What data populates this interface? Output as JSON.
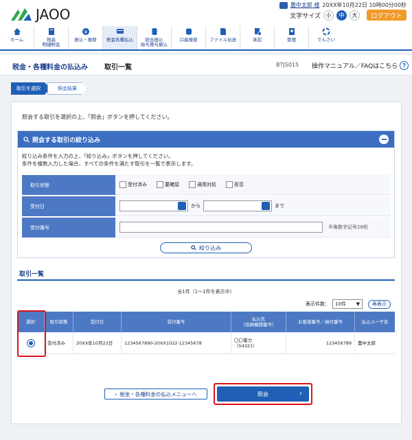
{
  "brand": {
    "name": "JAOO",
    "color": "#1f5fb5"
  },
  "header": {
    "user_name": "農中太郎 様",
    "datetime": "20XX年10月22日 10時00分00秒",
    "font_size_label": "文字サイズ",
    "font_sizes": [
      "小",
      "中",
      "大"
    ],
    "logout_label": "ログアウト"
  },
  "nav": [
    {
      "label": "ホーム",
      "icon": "home-icon"
    },
    {
      "label": "残高\n明細照会",
      "icon": "book-icon"
    },
    {
      "label": "振込・振替",
      "icon": "yen-icon"
    },
    {
      "label": "税金各種払込",
      "icon": "card-icon"
    },
    {
      "label": "総合振込\n給与賞与振込",
      "icon": "stack-icon"
    },
    {
      "label": "口座振替",
      "icon": "coins-icon"
    },
    {
      "label": "ファイル伝送",
      "icon": "file-icon"
    },
    {
      "label": "承認",
      "icon": "approve-icon"
    },
    {
      "label": "管理",
      "icon": "admin-icon"
    },
    {
      "label": "でんさい",
      "icon": "densai-icon"
    }
  ],
  "title": {
    "main": "税金・各種料金の払込み",
    "sub": "取引一覧",
    "code": "BTJS015",
    "help": "操作マニュアル／FAQはこちら"
  },
  "steps": [
    "取引を選択",
    "照会結果"
  ],
  "instruction": "照会する取引を選択の上、「照会」ボタンを押してください。",
  "filter": {
    "title": "照会する取引の絞り込み",
    "desc1": "絞り込み条件を入力の上、「絞り込み」ボタンを押してください。",
    "desc2": "条件を複数入力した場合、すべての条件を満たす取引を一覧で表示します。",
    "status_label": "取引状態",
    "status_options": [
      "受付済み",
      "要確認",
      "適用対処",
      "拒否"
    ],
    "date_label": "受付日",
    "date_from": "から",
    "date_to": "まで",
    "number_label": "受付番号",
    "number_hint": "半角数字記号28桁",
    "search_label": "絞り込み"
  },
  "list": {
    "title": "取引一覧",
    "count": "全1件（1～1件を表示中）",
    "perpage_label": "表示件数：",
    "perpage_value": "10件",
    "redisplay_label": "再表示",
    "columns": [
      "選択",
      "取引状態",
      "受付日",
      "受付番号",
      "払込先\n（収納機関番号）",
      "お客様番号／納付番号",
      "払込ユーザ名"
    ],
    "rows": [
      {
        "status": "受付済み",
        "date": "20XX年10月22日",
        "number": "1234567890-20XX1022-12345678",
        "payee": "〇〇電力\n（54321）",
        "customer_no": "123456789",
        "user": "農中太郎"
      }
    ]
  },
  "buttons": {
    "back_label": "税金・各種料金の払込メニューへ",
    "inquire_label": "照会"
  }
}
